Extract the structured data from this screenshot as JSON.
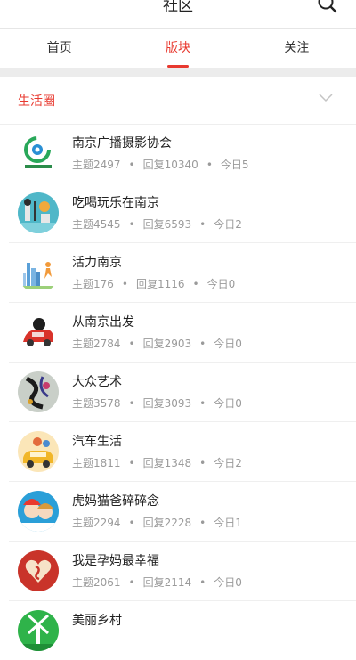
{
  "header": {
    "title": "社区",
    "search_icon": "search-icon"
  },
  "tabs": [
    {
      "label": "首页",
      "active": false
    },
    {
      "label": "版块",
      "active": true
    },
    {
      "label": "关注",
      "active": false
    }
  ],
  "section": {
    "title": "生活圈",
    "toggle_icon": "chevron-down-icon"
  },
  "colors": {
    "accent": "#e8392f",
    "muted_text": "#9a9a9a",
    "divider": "#ececec"
  },
  "forums": [
    {
      "name": "南京广播摄影协会",
      "topics": "主题2497",
      "replies": "回复10340",
      "today": "今日5",
      "avatar_icon": "photography-logo-icon"
    },
    {
      "name": "吃喝玩乐在南京",
      "topics": "主题4545",
      "replies": "回复6593",
      "today": "今日2",
      "avatar_icon": "food-fun-icon"
    },
    {
      "name": "活力南京",
      "topics": "主题176",
      "replies": "回复1116",
      "today": "今日0",
      "avatar_icon": "city-skyline-icon"
    },
    {
      "name": "从南京出发",
      "topics": "主题2784",
      "replies": "回复2903",
      "today": "今日0",
      "avatar_icon": "car-travel-icon"
    },
    {
      "name": "大众艺术",
      "topics": "主题3578",
      "replies": "回复3093",
      "today": "今日0",
      "avatar_icon": "art-icon"
    },
    {
      "name": "汽车生活",
      "topics": "主题1811",
      "replies": "回复1348",
      "today": "今日2",
      "avatar_icon": "car-life-icon"
    },
    {
      "name": "虎妈猫爸碎碎念",
      "topics": "主题2294",
      "replies": "回复2228",
      "today": "今日1",
      "avatar_icon": "parents-icon"
    },
    {
      "name": "我是孕妈最幸福",
      "topics": "主题2061",
      "replies": "回复2114",
      "today": "今日0",
      "avatar_icon": "heart-mom-icon"
    },
    {
      "name": "美丽乡村",
      "topics": "",
      "replies": "",
      "today": "",
      "avatar_icon": "windmill-icon"
    }
  ]
}
